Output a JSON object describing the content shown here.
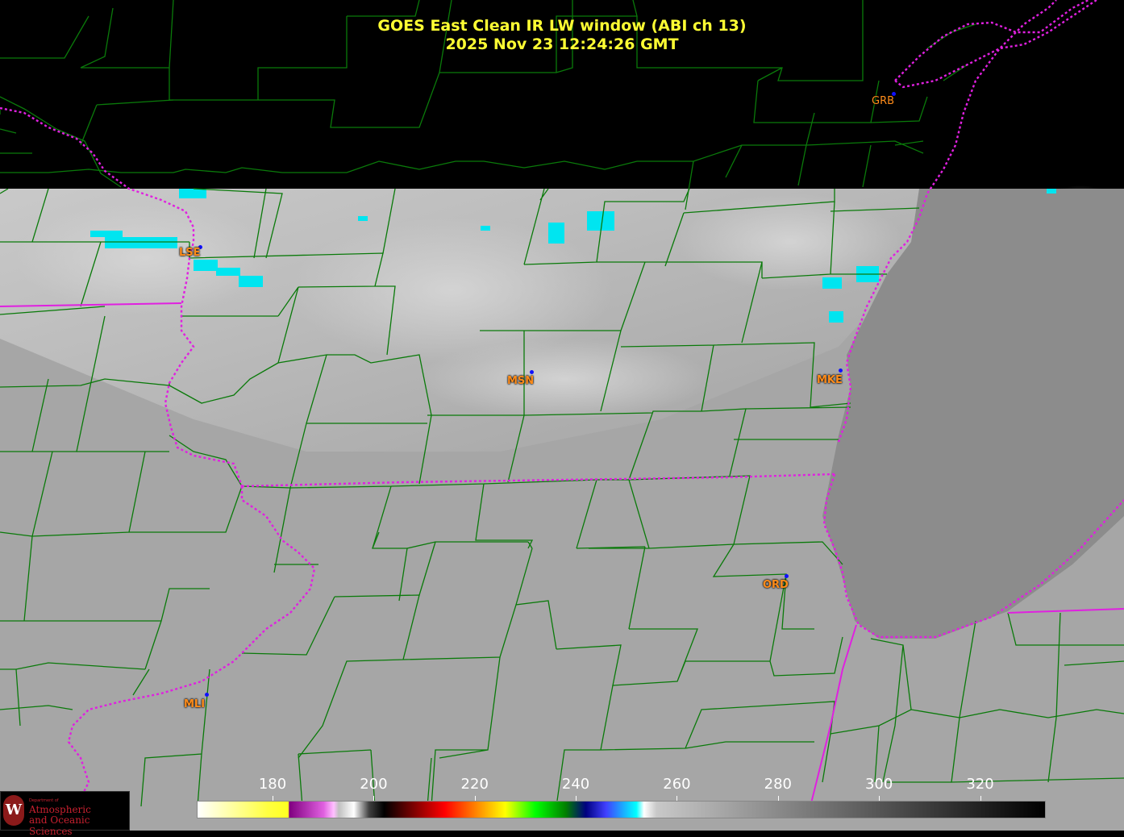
{
  "title": {
    "line1": "GOES East Clean IR LW window (ABI ch 13)",
    "line2": "2025 Nov 23  12:24:26 GMT"
  },
  "stations": [
    {
      "id": "GRB"
    },
    {
      "id": "LSE"
    },
    {
      "id": "MSN"
    },
    {
      "id": "MKE"
    },
    {
      "id": "ORD"
    },
    {
      "id": "MLI"
    }
  ],
  "colorbar": {
    "ticks": [
      "180",
      "200",
      "220",
      "240",
      "260",
      "280",
      "300",
      "320"
    ],
    "range": [
      165,
      333
    ]
  },
  "colors": {
    "title": "#ffff33",
    "station_label": "#ff8c1a",
    "county_lines": "#0a7a0a",
    "state_lines": "#e020e0",
    "background": "#000000"
  },
  "logo": {
    "dept_text": "Department of",
    "line1": "Atmospheric",
    "line2": "and Oceanic Sciences",
    "seal_letter": "W"
  }
}
